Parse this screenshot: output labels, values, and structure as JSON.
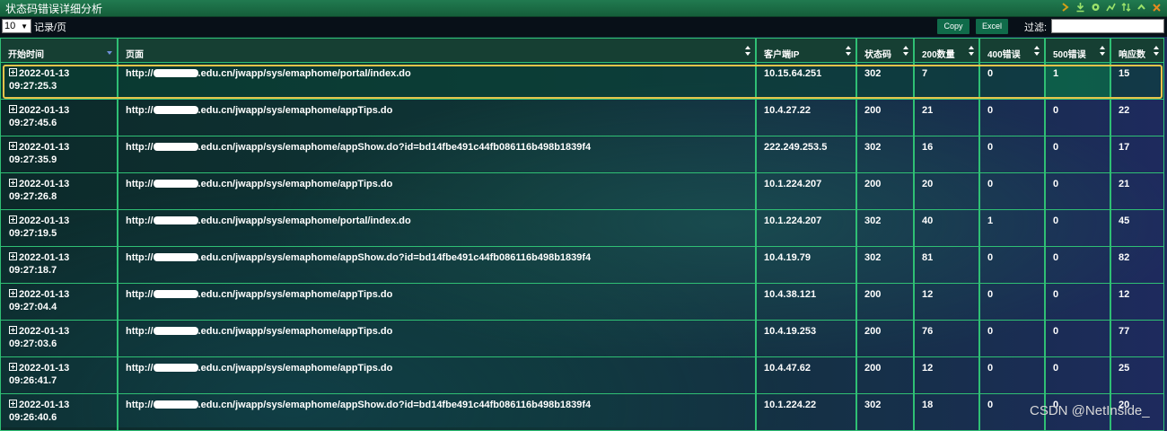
{
  "window": {
    "title": "状态码错误详细分析",
    "icons": [
      "chevron-right-icon",
      "download-icon",
      "gear-icon",
      "line-chart-icon",
      "sort-icon",
      "chevron-up-icon",
      "close-icon"
    ]
  },
  "toolbar": {
    "page_size": "10",
    "page_size_label": "记录/页",
    "copy_label": "Copy",
    "excel_label": "Excel",
    "filter_label": "过滤:",
    "filter_value": ""
  },
  "table": {
    "columns": [
      "开始时间",
      "页面",
      "客户端IP",
      "状态码",
      "200数量",
      "400错误",
      "500错误",
      "响应数"
    ],
    "rows": [
      {
        "date": "2022-01-13",
        "time": "09:27:25.3",
        "url_prefix": "http://",
        "url_suffix": ".edu.cn/jwapp/sys/emaphome/portal/index.do",
        "ip": "10.15.64.251",
        "status": "302",
        "c200": "7",
        "e400": "0",
        "e500": "1",
        "resp": "15"
      },
      {
        "date": "2022-01-13",
        "time": "09:27:45.6",
        "url_prefix": "http://",
        "url_suffix": ".edu.cn/jwapp/sys/emaphome/appTips.do",
        "ip": "10.4.27.22",
        "status": "200",
        "c200": "21",
        "e400": "0",
        "e500": "0",
        "resp": "22"
      },
      {
        "date": "2022-01-13",
        "time": "09:27:35.9",
        "url_prefix": "http://",
        "url_suffix": ".edu.cn/jwapp/sys/emaphome/appShow.do?id=bd14fbe491c44fb086116b498b1839f4",
        "ip": "222.249.253.5",
        "status": "302",
        "c200": "16",
        "e400": "0",
        "e500": "0",
        "resp": "17"
      },
      {
        "date": "2022-01-13",
        "time": "09:27:26.8",
        "url_prefix": "http://",
        "url_suffix": ".edu.cn/jwapp/sys/emaphome/appTips.do",
        "ip": "10.1.224.207",
        "status": "200",
        "c200": "20",
        "e400": "0",
        "e500": "0",
        "resp": "21"
      },
      {
        "date": "2022-01-13",
        "time": "09:27:19.5",
        "url_prefix": "http://",
        "url_suffix": ".edu.cn/jwapp/sys/emaphome/portal/index.do",
        "ip": "10.1.224.207",
        "status": "302",
        "c200": "40",
        "e400": "1",
        "e500": "0",
        "resp": "45"
      },
      {
        "date": "2022-01-13",
        "time": "09:27:18.7",
        "url_prefix": "http://",
        "url_suffix": ".edu.cn/jwapp/sys/emaphome/appShow.do?id=bd14fbe491c44fb086116b498b1839f4",
        "ip": "10.4.19.79",
        "status": "302",
        "c200": "81",
        "e400": "0",
        "e500": "0",
        "resp": "82"
      },
      {
        "date": "2022-01-13",
        "time": "09:27:04.4",
        "url_prefix": "http://",
        "url_suffix": ".edu.cn/jwapp/sys/emaphome/appTips.do",
        "ip": "10.4.38.121",
        "status": "200",
        "c200": "12",
        "e400": "0",
        "e500": "0",
        "resp": "12"
      },
      {
        "date": "2022-01-13",
        "time": "09:27:03.6",
        "url_prefix": "http://",
        "url_suffix": ".edu.cn/jwapp/sys/emaphome/appTips.do",
        "ip": "10.4.19.253",
        "status": "200",
        "c200": "76",
        "e400": "0",
        "e500": "0",
        "resp": "77"
      },
      {
        "date": "2022-01-13",
        "time": "09:26:41.7",
        "url_prefix": "http://",
        "url_suffix": ".edu.cn/jwapp/sys/emaphome/appTips.do",
        "ip": "10.4.47.62",
        "status": "200",
        "c200": "12",
        "e400": "0",
        "e500": "0",
        "resp": "25"
      },
      {
        "date": "2022-01-13",
        "time": "09:26:40.6",
        "url_prefix": "http://",
        "url_suffix": ".edu.cn/jwapp/sys/emaphome/appShow.do?id=bd14fbe491c44fb086116b498b1839f4",
        "ip": "10.1.224.22",
        "status": "302",
        "c200": "18",
        "e400": "0",
        "e500": "0",
        "resp": "20"
      }
    ],
    "selected_row": 0
  },
  "watermark": "CSDN @NetInside_",
  "colors": {
    "title_bar": "#1a6b44",
    "grid_border": "#2fbf74",
    "highlight": "#e6c34a",
    "icon_yellow": "#d4a017",
    "icon_green": "#9be36b",
    "button": "#106b4a"
  }
}
